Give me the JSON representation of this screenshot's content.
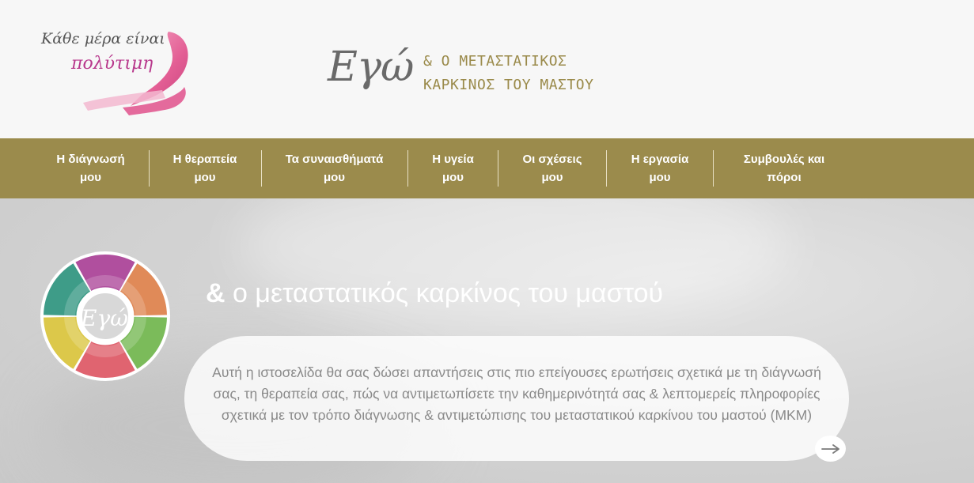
{
  "header": {
    "logo_line1": "Κάθε μέρα είναι",
    "logo_line2": "πολύτιμη",
    "brand_title": "Εγώ",
    "brand_subtitle_line1": "& Ο ΜΕΤΑΣΤΑΤΙΚΟΣ",
    "brand_subtitle_line2": "ΚΑΡΚΙΝΟΣ ΤΟΥ ΜΑΣΤΟΥ"
  },
  "nav": {
    "items": [
      {
        "line1": "Η διάγνωσή",
        "line2": "μου"
      },
      {
        "line1": "Η θεραπεία",
        "line2": "μου"
      },
      {
        "line1": "Τα συναισθήματά",
        "line2": "μου"
      },
      {
        "line1": "Η υγεία",
        "line2": "μου"
      },
      {
        "line1": "Οι σχέσεις",
        "line2": "μου"
      },
      {
        "line1": "Η εργασία",
        "line2": "μου"
      },
      {
        "line1": "Συμβουλές και",
        "line2": "πόροι"
      }
    ]
  },
  "hero": {
    "wheel_label": "Εγώ",
    "title_amp": "&",
    "title": " ο μεταστατικός καρκίνος του μαστού",
    "description": "Αυτή η ιστοσελίδα θα σας δώσει απαντήσεις στις πιο επείγουσες ερωτήσεις σχετικά με τη διάγνωσή σας, τη θεραπεία σας, πώς να αντιμετωπίσετε την καθημερινότητά σας & λεπτομερείς πληροφορίες σχετικά με τον τρόπο διάγνωσης & αντιμετώπισης του μεταστατικού καρκίνου του μαστού (ΜΚΜ)",
    "arrow": "→"
  },
  "colors": {
    "nav_bg": "#9b8b4c",
    "brand_gold": "#9a8a4a",
    "ribbon_pink": "#e2568f",
    "wheel_purple": "#b04f9e",
    "wheel_orange": "#e08a58",
    "wheel_green": "#7bbb5a",
    "wheel_red": "#e06470",
    "wheel_yellow": "#dcc84a",
    "wheel_teal": "#3e9c88"
  },
  "icons": [
    "pink-ribbon-icon",
    "arrow-right-icon"
  ]
}
